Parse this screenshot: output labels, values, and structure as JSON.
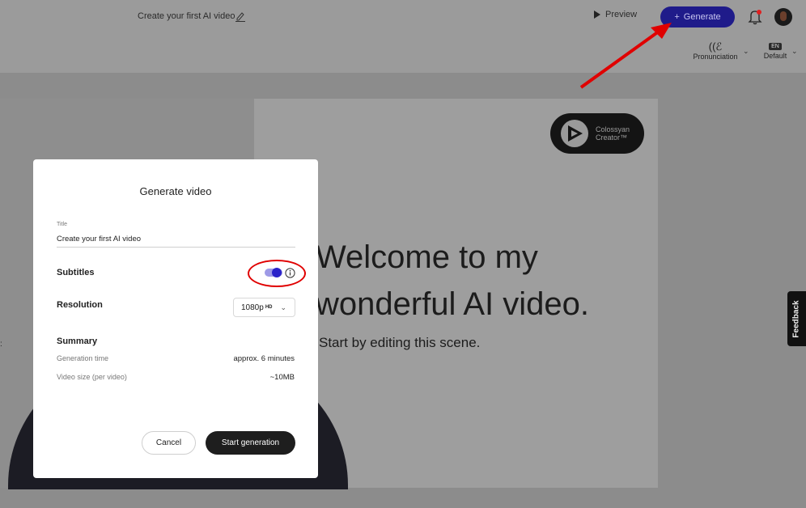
{
  "topbar": {
    "doc_title": "Create your first AI video",
    "preview_label": "Preview",
    "generate_label": "Generate",
    "generate_prefix": "+",
    "accent_color": "#1f1b8a"
  },
  "subbar": {
    "pronunciation_label": "Pronunciation",
    "language_badge": "EN",
    "language_label": "Default"
  },
  "slide": {
    "logo_line1": "Colossyan",
    "logo_line2": "Creator™",
    "headline_line1": "Welcome to my",
    "headline_line2": "wonderful AI video.",
    "subtitle": "Start by editing this scene.",
    "feedback_label": "Feedback"
  },
  "modal": {
    "title": "Generate video",
    "title_field_label": "Title",
    "title_field_value": "Create your first AI video",
    "subtitles_label": "Subtitles",
    "subtitles_enabled": true,
    "resolution_label": "Resolution",
    "resolution_value": "1080p",
    "resolution_badge": "HD",
    "summary_label": "Summary",
    "generation_time_label": "Generation time",
    "generation_time_value": "approx. 6 minutes",
    "video_size_label": "Video size (per video)",
    "video_size_value": "~10MB",
    "cancel_label": "Cancel",
    "start_label": "Start generation"
  },
  "icons": {
    "edit": "pencil-icon",
    "play": "play-icon",
    "bell": "bell-icon",
    "info": "info-icon",
    "chevron": "chevron-down-icon"
  }
}
